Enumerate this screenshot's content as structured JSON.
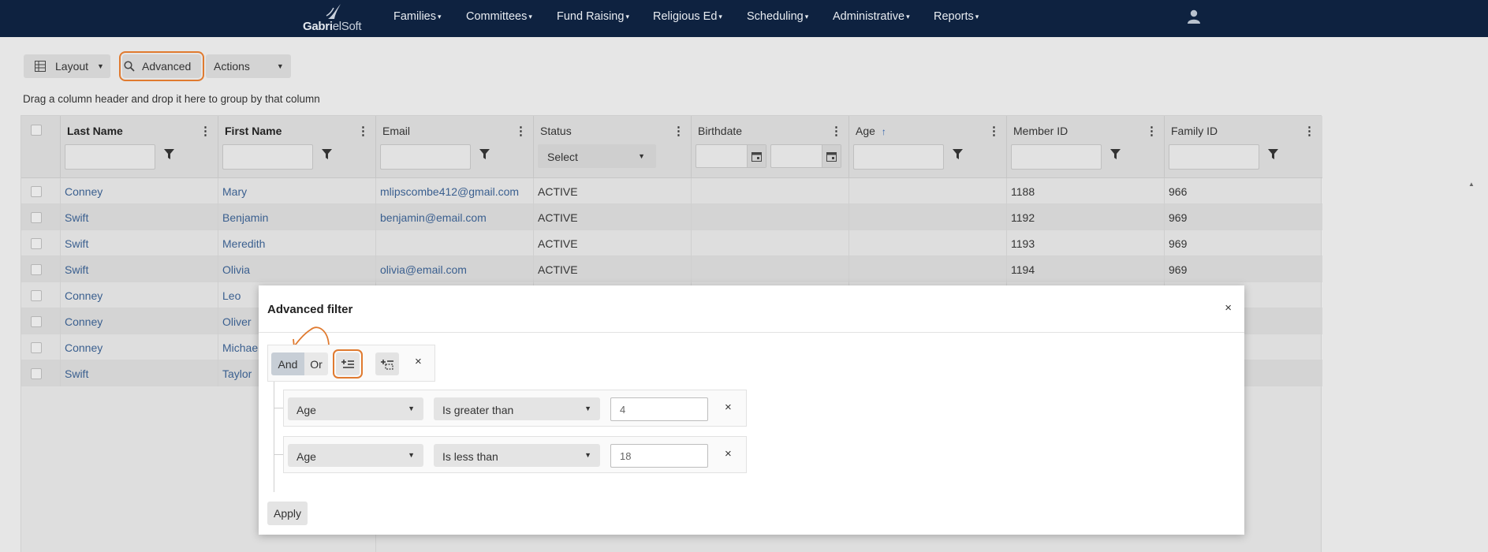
{
  "nav": {
    "logo_text_1": "Gabr",
    "logo_text_2": "i",
    "logo_text_3": "elSoft",
    "items": [
      {
        "label": "Families"
      },
      {
        "label": "Committees"
      },
      {
        "label": "Fund Raising"
      },
      {
        "label": "Religious Ed"
      },
      {
        "label": "Scheduling"
      },
      {
        "label": "Administrative"
      },
      {
        "label": "Reports"
      }
    ]
  },
  "toolbar": {
    "layout_label": "Layout",
    "advanced_label": "Advanced",
    "actions_label": "Actions"
  },
  "group_hint": "Drag a column header and drop it here to group by that column",
  "grid": {
    "columns": [
      {
        "label": "Last Name"
      },
      {
        "label": "First Name"
      },
      {
        "label": "Email"
      },
      {
        "label": "Status"
      },
      {
        "label": "Birthdate"
      },
      {
        "label": "Age"
      },
      {
        "label": "Member ID"
      },
      {
        "label": "Family ID"
      }
    ],
    "status_filter": "Select",
    "rows": [
      {
        "last": "Conney",
        "first": "Mary",
        "email": "mlipscombe412@gmail.com",
        "status": "ACTIVE",
        "member_id": "1188",
        "family_id": "966"
      },
      {
        "last": "Swift",
        "first": "Benjamin",
        "email": "benjamin@email.com",
        "status": "ACTIVE",
        "member_id": "1192",
        "family_id": "969"
      },
      {
        "last": "Swift",
        "first": "Meredith",
        "email": "",
        "status": "ACTIVE",
        "member_id": "1193",
        "family_id": "969"
      },
      {
        "last": "Swift",
        "first": "Olivia",
        "email": "olivia@email.com",
        "status": "ACTIVE",
        "member_id": "1194",
        "family_id": "969"
      },
      {
        "last": "Conney",
        "first": "Leo",
        "email": "",
        "status": "",
        "member_id": "",
        "family_id": ""
      },
      {
        "last": "Conney",
        "first": "Oliver",
        "email": "",
        "status": "",
        "member_id": "",
        "family_id": ""
      },
      {
        "last": "Conney",
        "first": "Michae",
        "email": "",
        "status": "",
        "member_id": "",
        "family_id": ""
      },
      {
        "last": "Swift",
        "first": "Taylor",
        "email": "",
        "status": "",
        "member_id": "",
        "family_id": ""
      }
    ]
  },
  "modal": {
    "title": "Advanced filter",
    "close_glyph": "×",
    "logic_and": "And",
    "logic_or": "Or",
    "logic_remove": "×",
    "conditions": [
      {
        "field": "Age",
        "operator": "Is greater than",
        "value": "4",
        "remove": "×"
      },
      {
        "field": "Age",
        "operator": "Is less than",
        "value": "18",
        "remove": "×"
      }
    ],
    "apply_label": "Apply"
  },
  "colors": {
    "nav_bg": "#0e2240",
    "highlight": "#e07a2f",
    "link": "#3a5f8f"
  }
}
